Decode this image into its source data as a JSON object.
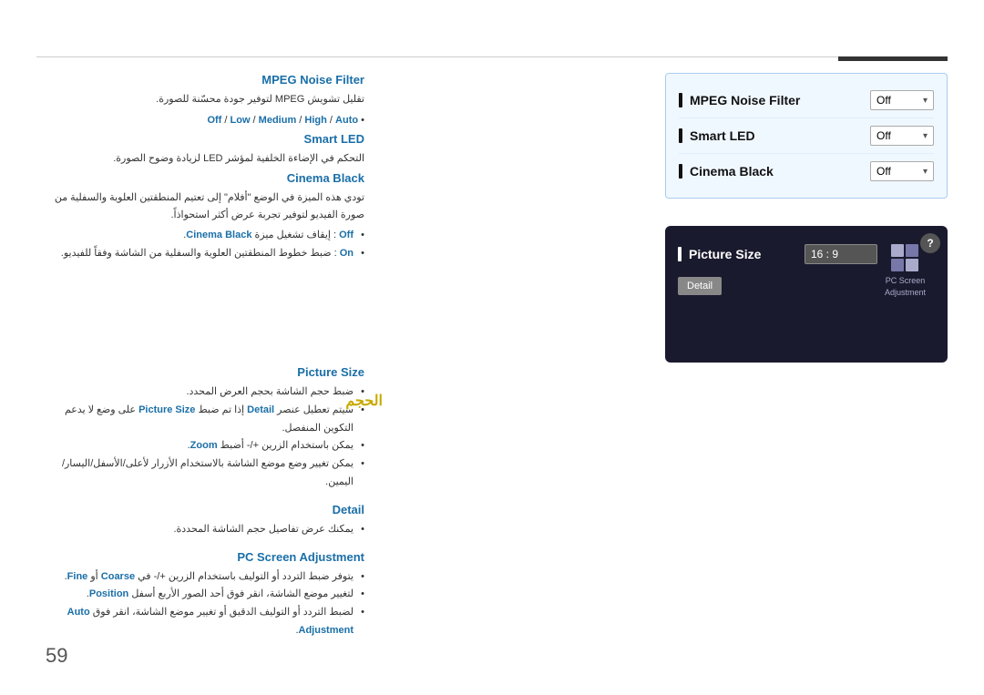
{
  "page": {
    "number": "59"
  },
  "sections": {
    "mpeg": {
      "title": "MPEG Noise Filter",
      "description": "تقليل تشويش MPEG لتوفير جودة محسّنة للصورة.",
      "options_label": "Auto / High / Medium / Low / Off",
      "options": [
        "Off",
        "Low",
        "Medium",
        "High",
        "Auto"
      ]
    },
    "smart_led": {
      "title": "Smart LED",
      "description": "التحكم في الإضاءة الخلفية لمؤشر LED لزيادة وضوح الصورة."
    },
    "cinema_black": {
      "title": "Cinema Black",
      "description": "تودي هذه الميزة في الوضع \"أفلام\" إلى تعتيم المنطقتين العلوية والسفلية من صورة الفيديو لتوفير تجربة عرض أكثر استحواذاً.",
      "bullets": [
        "Off : إيقاف تشغيل ميزة Cinema Black.",
        "On : ضبط خطوط المنطقتين العلوية والسفلية من الشاشة وفقاً للفيديو."
      ]
    },
    "picture_size": {
      "title": "Picture Size",
      "description": "ضبط حجم الشاشة بحجم العرض المحدد.",
      "bullets": [
        "سيتم تعطيل عنصر Detail إذا تم ضبط Picture Size على وضع لا يدعم التكوين المنفصل.",
        "يمكن باستخدام الزرين +/- أضبط Zoom.",
        "يمكن تغيير وضع موضع الشاشة بالاستخدام الأزرار لأعلى/الأسفل/اليسار/اليمين."
      ]
    },
    "detail": {
      "title": "Detail",
      "bullets": [
        "يمكنك عرض تفاصيل حجم الشاشة المحددة."
      ]
    },
    "pc_screen": {
      "title": "PC Screen Adjustment",
      "bullets": [
        "يتوفر ضبط التردد أو التوليف باستخدام الزرين +/- في Coarse أو Fine.",
        "لتغيير موضع الشاشة، انقر فوق أحد الصور الأربع أسفل Position.",
        "لضبط التردد أو التوليف الدقيق أو تغيير موضع الشاشة، انقر فوق Auto Adjustment."
      ]
    }
  },
  "right_panel": {
    "top": {
      "rows": [
        {
          "label": "MPEG Noise Filter",
          "value": "Off"
        },
        {
          "label": "Smart LED",
          "value": "Off"
        },
        {
          "label": "Cinema Black",
          "value": "Off"
        }
      ]
    },
    "bottom": {
      "label": "Picture Size",
      "value": "16 : 9",
      "detail_btn": "Detail",
      "pc_screen_label": "PC Screen Adjustment"
    }
  },
  "hajm": "الحجم",
  "icons": {
    "question": "?",
    "dropdown": "▾"
  }
}
